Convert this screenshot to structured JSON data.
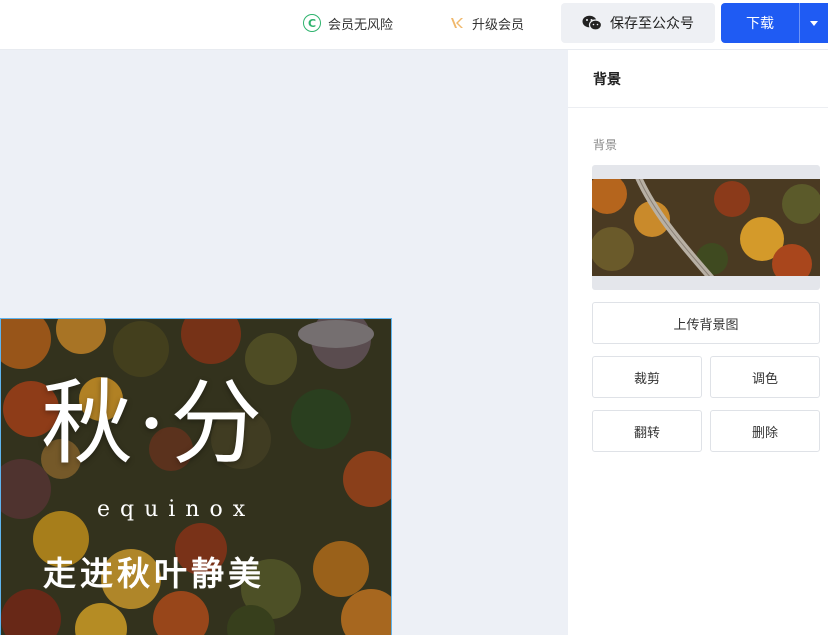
{
  "topbar": {
    "risk_free_label": "会员无风险",
    "risk_free_icon": "copyright-icon",
    "upgrade_label": "升级会员",
    "upgrade_icon": "crown-icon",
    "wechat_label": "保存至公众号",
    "wechat_icon": "wechat-icon",
    "download_label": "下载",
    "download_dropdown_icon": "caret-down-icon",
    "accent": "#1f5bf3",
    "risk_icon_color": "#2fb36e"
  },
  "poster": {
    "title": "秋·分",
    "subtitle": "equinox",
    "slogan": "走进秋叶静美"
  },
  "panel": {
    "header": "背景",
    "section_label": "背景",
    "buttons": {
      "upload": "上传背景图",
      "crop": "裁剪",
      "color": "调色",
      "flip": "翻转",
      "delete": "删除"
    }
  }
}
